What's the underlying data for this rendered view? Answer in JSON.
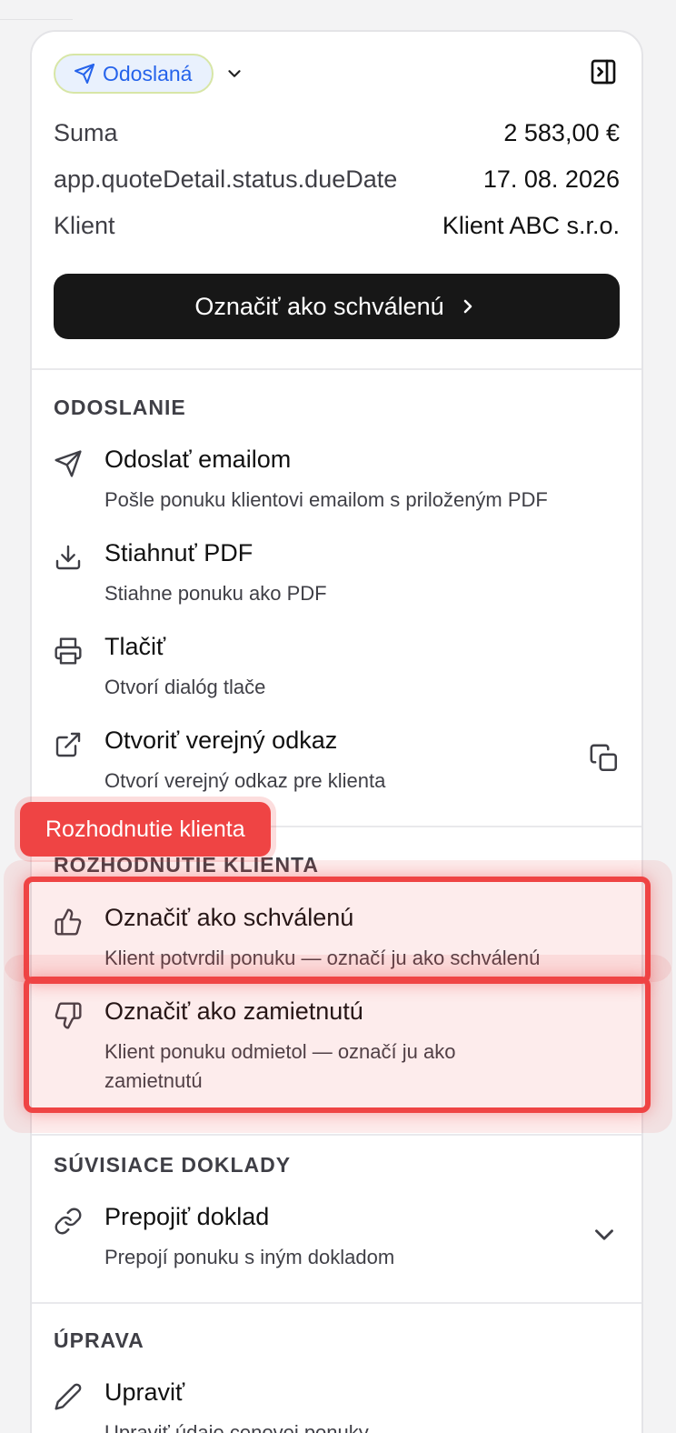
{
  "status": {
    "label": "Odoslaná",
    "icon": "send-icon"
  },
  "summary": [
    {
      "label": "Suma",
      "value": "2 583,00 €"
    },
    {
      "label": "app.quoteDetail.status.dueDate",
      "value": "17. 08. 2026"
    },
    {
      "label": "Klient",
      "value": "Klient ABC s.r.o."
    }
  ],
  "primary_action": {
    "label": "Označiť ako schválenú"
  },
  "sections": {
    "odoslanie": {
      "title": "ODOSLANIE",
      "items": [
        {
          "title": "Odoslať emailom",
          "desc": "Pošle ponuku klientovi emailom s priloženým PDF",
          "icon": "send-icon"
        },
        {
          "title": "Stiahnuť PDF",
          "desc": "Stiahne ponuku ako PDF",
          "icon": "download-icon"
        },
        {
          "title": "Tlačiť",
          "desc": "Otvorí dialóg tlače",
          "icon": "printer-icon"
        },
        {
          "title": "Otvoriť verejný odkaz",
          "desc": "Otvorí verejný odkaz pre klienta",
          "icon": "external-link-icon"
        }
      ]
    },
    "rozhodnutie": {
      "title": "ROZHODNUTIE KLIENTA",
      "items": [
        {
          "title": "Označiť ako schválenú",
          "desc": "Klient potvrdil ponuku — označí ju ako schválenú",
          "icon": "thumbs-up-icon"
        },
        {
          "title": "Označiť ako zamietnutú",
          "desc": "Klient ponuku odmietol — označí ju ako zamietnutú",
          "icon": "thumbs-down-icon"
        }
      ]
    },
    "suvisiace": {
      "title": "SÚVISIACE DOKLADY",
      "items": [
        {
          "title": "Prepojiť doklad",
          "desc": "Prepojí ponuku s iným dokladom",
          "icon": "link-icon"
        }
      ]
    },
    "uprava": {
      "title": "ÚPRAVA",
      "items": [
        {
          "title": "Upraviť",
          "desc": "Upraviť údaje cenovej ponuky",
          "icon": "pencil-icon"
        }
      ]
    }
  },
  "tooltip": {
    "label": "Rozhodnutie klienta"
  },
  "colors": {
    "accent_red": "#ef4444",
    "badge_blue": "#2563eb",
    "dark_button": "#171717"
  }
}
